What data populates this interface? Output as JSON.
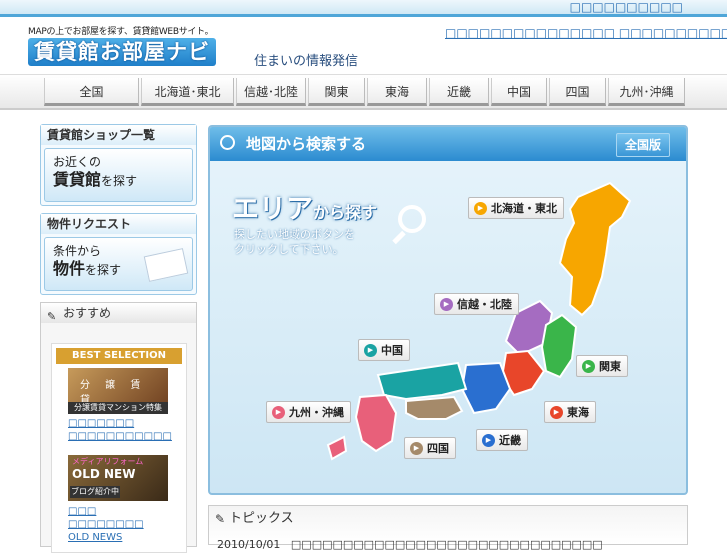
{
  "top_links": "□□□□□□□□□□",
  "header": {
    "tagline": "MAPの上でお部屋を探す、賃貸館WEBサイト。",
    "logo": "賃貸館お部屋ナビ",
    "subtitle": "住まいの情報発信",
    "links": "□□□□□□□□□□□□□□□ □□□□□□□□□□□□"
  },
  "nav": [
    "全国",
    "北海道･東北",
    "信越･北陸",
    "関東",
    "東海",
    "近畿",
    "中国",
    "四国",
    "九州･沖縄"
  ],
  "sidebar": {
    "shop_title": "賃貸館ショップ一覧",
    "shop_card": [
      "お近くの",
      "賃貸館",
      "を探す"
    ],
    "request_title": "物件リクエスト",
    "request_card": [
      "条件から",
      "物件",
      "を探す"
    ],
    "rec_title": "おすすめ",
    "best": "BEST SELECTION",
    "thumb1_caption": "分譲賃貸マンション特集",
    "thumb1_chars": "分 譲 賃 貸",
    "links1": [
      "□□□□□□□",
      "□□□□□□□□□□□"
    ],
    "thumb2_top": "メディアリフォーム",
    "thumb2_main": "OLD NEW",
    "thumb2_caption": "ブログ紹介中",
    "links2": [
      "□□□",
      "□□□□□□□□",
      "OLD NEWS"
    ]
  },
  "map": {
    "header": "地図から検索する",
    "zenkoku": "全国版",
    "big": "エリア",
    "big_small": "から探す",
    "hint1": "探したい地域のボタンを",
    "hint2": "クリックして下さい。",
    "regions": {
      "hokkaido": "北海道・東北",
      "shinetsu": "信越・北陸",
      "chugoku": "中国",
      "kanto": "関東",
      "kyushu": "九州・沖縄",
      "tokai": "東海",
      "kinki": "近畿",
      "shikoku": "四国"
    },
    "colors": {
      "hokkaido": "#f7a600",
      "shinetsu": "#a56cc1",
      "chugoku": "#1aa3a3",
      "kanto": "#3ab54a",
      "kyushu": "#e8607a",
      "tokai": "#e8462a",
      "kinki": "#2a6fd0",
      "shikoku": "#a58a6a"
    }
  },
  "topics": {
    "title": "トピックス",
    "date": "2010/10/01",
    "text": "□□□□□□□□□□□□□□□□□□□□□□□□□□□□□□"
  }
}
